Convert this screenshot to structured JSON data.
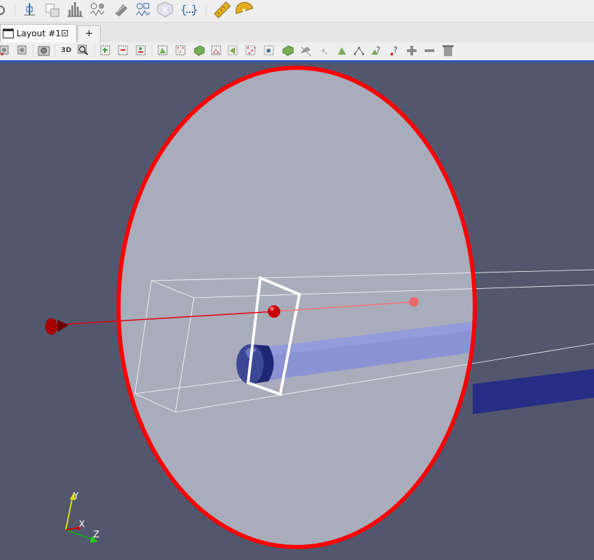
{
  "tabs": {
    "active_label": "Layout #1",
    "close_glyph": "×",
    "add_label": "+"
  },
  "camera_toolbar": {
    "label_3d": "3D"
  },
  "axes_triad": {
    "y_label": "Y",
    "x_label": "X",
    "z_label": "Z"
  },
  "colors": {
    "viewport_bg": "#52576e",
    "disc_edge": "#ff0000",
    "disc_fill": "#a9acbb",
    "tube": "#28308a",
    "tube_highlight": "#8c93d4",
    "toolbar_bg": "#efefef",
    "accent": "#1e5bc6"
  },
  "icons": {
    "toolbar1": [
      "partial-circle-icon",
      "probe-location-icon",
      "plot-over-line-icon",
      "histogram-icon",
      "plot-data-over-time-icon",
      "python-calculator-icon",
      "plot-selection-over-time-icon",
      "calculator-shield-icon",
      "python-braces-icon",
      "ruler-icon",
      "protractor-icon"
    ],
    "toolbar2": [
      "reset-camera-icon",
      "zoom-to-data-icon",
      "screenshot-icon",
      "zoom-to-box-icon",
      "select-cells-on-icon",
      "select-points-on-icon",
      "select-cells-polygon-icon",
      "select-cells-frustum-icon",
      "select-points-frustum-icon",
      "select-block-icon",
      "interactive-select-cells-icon",
      "interactive-select-points-icon",
      "hover-points-icon",
      "hover-cells-icon",
      "grow-selection-icon",
      "shrink-selection-icon",
      "clear-selection-icon"
    ]
  }
}
